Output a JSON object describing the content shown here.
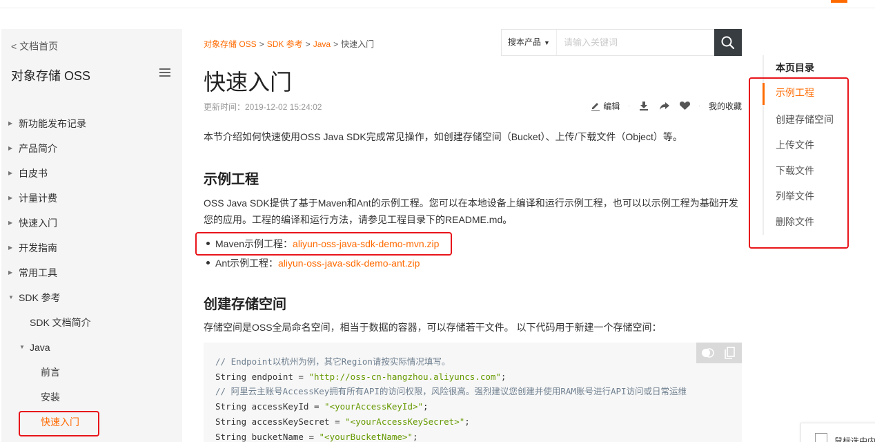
{
  "sidebar": {
    "home_link": "< 文档首页",
    "product_title": "对象存储 OSS",
    "menu_icon": "hamburger-icon",
    "items": [
      {
        "label": "新功能发布记录",
        "level": 0,
        "caret": "right"
      },
      {
        "label": "产品简介",
        "level": 0,
        "caret": "right"
      },
      {
        "label": "白皮书",
        "level": 0,
        "caret": "right"
      },
      {
        "label": "计量计费",
        "level": 0,
        "caret": "right"
      },
      {
        "label": "快速入门",
        "level": 0,
        "caret": "right"
      },
      {
        "label": "开发指南",
        "level": 0,
        "caret": "right"
      },
      {
        "label": "常用工具",
        "level": 0,
        "caret": "right"
      },
      {
        "label": "SDK 参考",
        "level": 0,
        "caret": "down"
      },
      {
        "label": "SDK 文档简介",
        "level": 1,
        "caret": ""
      },
      {
        "label": "Java",
        "level": 1,
        "caret": "down"
      },
      {
        "label": "前言",
        "level": 2,
        "caret": ""
      },
      {
        "label": "安装",
        "level": 2,
        "caret": ""
      },
      {
        "label": "快速入门",
        "level": 2,
        "caret": "",
        "active": true
      }
    ]
  },
  "breadcrumb": {
    "items": [
      "对象存储 OSS",
      "SDK 参考",
      "Java"
    ],
    "current": "快速入门",
    "separator": ">"
  },
  "search": {
    "scope": "搜本产品",
    "placeholder": "请输入关键词",
    "button_icon": "search-icon"
  },
  "article": {
    "title": "快速入门",
    "updated": "更新时间：2019-12-02 15:24:02",
    "toolbar": {
      "edit_label": "编辑",
      "favorite_label": "我的收藏",
      "icons": [
        "edit-icon",
        "download-icon",
        "share-icon",
        "heart-icon"
      ]
    },
    "intro": "本节介绍如何快速使用OSS Java SDK完成常见操作，如创建存储空间（Bucket）、上传/下载文件（Object）等。",
    "section1": {
      "heading": "示例工程",
      "para": "OSS Java SDK提供了基于Maven和Ant的示例工程。您可以在本地设备上编译和运行示例工程，也可以以示例工程为基础开发您的应用。工程的编译和运行方法，请参见工程目录下的README.md。",
      "bullets": [
        {
          "prefix": "Maven示例工程：",
          "link": "aliyun-oss-java-sdk-demo-mvn.zip"
        },
        {
          "prefix": "Ant示例工程：",
          "link": "aliyun-oss-java-sdk-demo-ant.zip"
        }
      ]
    },
    "section2": {
      "heading": "创建存储空间",
      "para": "存储空间是OSS全局命名空间，相当于数据的容器，可以存储若干文件。 以下代码用于新建一个存储空间："
    },
    "code": {
      "line1": "// Endpoint以杭州为例，其它Region请按实际情况填写。",
      "line2a": "String endpoint = ",
      "line2b": "\"http://oss-cn-hangzhou.aliyuncs.com\"",
      "line3": "// 阿里云主账号AccessKey拥有所有API的访问权限，风险很高。强烈建议您创建并使用RAM账号进行API访问或日常运维",
      "line4a": "String accessKeyId = ",
      "line4b": "\"<yourAccessKeyId>\"",
      "line5a": "String accessKeySecret = ",
      "line5b": "\"<yourAccessKeySecret>\"",
      "line6a": "String bucketName = ",
      "line6b": "\"<yourBucketName>\"",
      "semicolon": ";",
      "tool_icons": [
        "toggle-theme-icon",
        "copy-icon"
      ]
    }
  },
  "toc": {
    "title": "本页目录",
    "items": [
      "示例工程",
      "创建存储空间",
      "上传文件",
      "下载文件",
      "列举文件",
      "删除文件"
    ],
    "active_index": 0
  },
  "float_hint": {
    "text": "鼠标选中内"
  },
  "colors": {
    "accent": "#ff6a00",
    "annotation": "#e8141a",
    "search_button": "#373d41"
  }
}
